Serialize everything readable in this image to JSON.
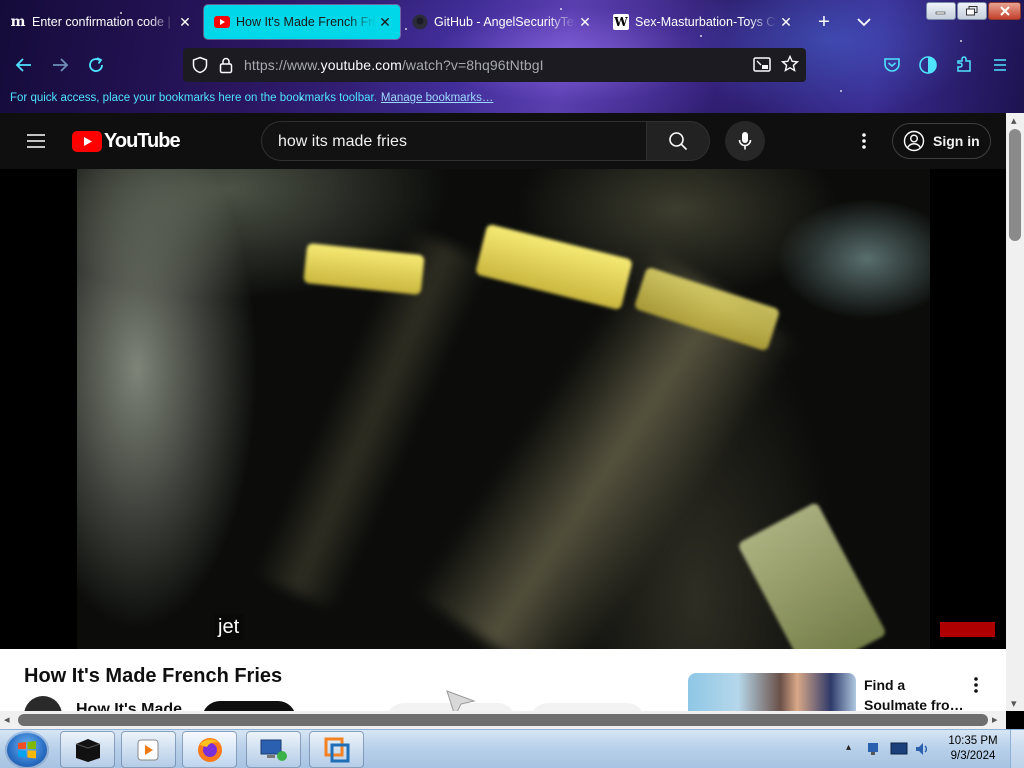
{
  "browser": {
    "tabs": [
      {
        "title": "Enter confirmation code | M",
        "favicon": "medium-m-icon"
      },
      {
        "title": "How It's Made French Fries",
        "favicon": "youtube-icon",
        "active": true
      },
      {
        "title": "GitHub - AngelSecurityTeam",
        "favicon": "github-icon"
      },
      {
        "title": "Sex-Masturbation-Toys Co",
        "favicon": "wikipedia-w-icon"
      }
    ],
    "new_tab_glyph": "+",
    "tab_list_glyph": "⌄",
    "url_prefix": "https://www.",
    "url_domain": "youtube.com",
    "url_path": "/watch?v=8hq96tNtbgI",
    "bookmarks_hint": "For quick access, place your bookmarks here on the bookmarks toolbar.",
    "bookmarks_link": "Manage bookmarks…",
    "theme_accent": "#00d7e8"
  },
  "youtube": {
    "logo_text": "YouTube",
    "search_query": "how its made fries",
    "sign_in_label": "Sign in",
    "caption_text": "jet",
    "video_title": "How It's Made French Fries",
    "channel_name": "How It's Made",
    "ad_title": "Find a Soulmate fro…",
    "brand_red": "#ff0000"
  },
  "taskbar": {
    "apps": [
      "terminal-icon",
      "media-player-icon",
      "firefox-icon",
      "network-computer-icon",
      "vmware-icon"
    ],
    "tray_chevron": "▴",
    "time": "10:35 PM",
    "date": "9/3/2024"
  }
}
